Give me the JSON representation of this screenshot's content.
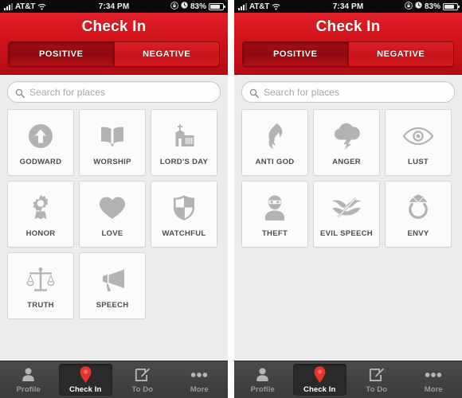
{
  "meta": {
    "colors": {
      "header_red_top": "#e22029",
      "header_red_bottom": "#b40d13",
      "segment_selected": "#a50d13",
      "page_background": "#ececec",
      "tile_background": "#fbfbfb",
      "tile_border": "#d5d5d5",
      "icon_gray": "#b3b3b3",
      "caption_gray": "#4d4d4d",
      "tabbar_background": "#3b3b3b",
      "tab_active_background": "#2a2a2a",
      "tab_pin_red": "#e8342b"
    }
  },
  "status_bar": {
    "carrier": "AT&T",
    "signal_icon": "signal-bars-icon",
    "wifi_icon": "wifi-icon",
    "time": "7:34 PM",
    "rotation_lock_icon": "rotation-lock-icon",
    "alarm_icon": "alarm-clock-icon",
    "battery_percent": "83%",
    "battery_level": 83,
    "battery_icon": "battery-icon"
  },
  "nav": {
    "title": "Check In"
  },
  "search": {
    "icon": "search-icon",
    "placeholder": "Search for places",
    "value": ""
  },
  "segments": {
    "positive_label": "POSITIVE",
    "negative_label": "NEGATIVE"
  },
  "panels": [
    {
      "id": "positive-panel",
      "selected_segment": "POSITIVE",
      "tiles": [
        {
          "label": "GODWARD",
          "icon": "arrow-up-circle-icon"
        },
        {
          "label": "WORSHIP",
          "icon": "open-book-icon"
        },
        {
          "label": "LORD'S DAY",
          "icon": "church-icon"
        },
        {
          "label": "HONOR",
          "icon": "award-ribbon-icon"
        },
        {
          "label": "LOVE",
          "icon": "heart-icon"
        },
        {
          "label": "WATCHFUL",
          "icon": "shield-icon"
        },
        {
          "label": "TRUTH",
          "icon": "scales-of-justice-icon"
        },
        {
          "label": "SPEECH",
          "icon": "megaphone-icon"
        }
      ]
    },
    {
      "id": "negative-panel",
      "selected_segment": "POSITIVE",
      "tiles": [
        {
          "label": "ANTI GOD",
          "icon": "flame-icon"
        },
        {
          "label": "ANGER",
          "icon": "storm-cloud-lightning-icon"
        },
        {
          "label": "LUST",
          "icon": "eye-icon"
        },
        {
          "label": "THEFT",
          "icon": "masked-burglar-icon"
        },
        {
          "label": "EVIL SPEECH",
          "icon": "lips-slashed-icon"
        },
        {
          "label": "ENVY",
          "icon": "diamond-ring-icon"
        }
      ]
    }
  ],
  "tab_bar": {
    "items": [
      {
        "label": "Profile",
        "icon": "person-icon",
        "active": false
      },
      {
        "label": "Check In",
        "icon": "map-pin-icon",
        "active": true
      },
      {
        "label": "To Do",
        "icon": "pencil-note-icon",
        "active": false
      },
      {
        "label": "More",
        "icon": "ellipsis-icon",
        "active": false
      }
    ]
  }
}
